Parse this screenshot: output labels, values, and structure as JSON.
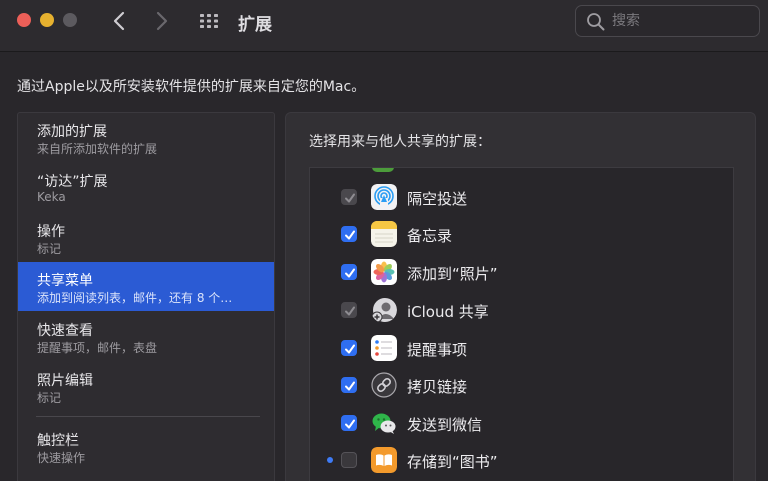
{
  "window": {
    "title": "扩展",
    "search_placeholder": "搜索"
  },
  "description": "通过Apple以及所安装软件提供的扩展来自定您的Mac。",
  "sidebar": {
    "items": [
      {
        "title": "添加的扩展",
        "subtitle": "来自所添加软件的扩展"
      },
      {
        "title": "“访达”扩展",
        "subtitle": "Keka"
      },
      {
        "title": "操作",
        "subtitle": "标记"
      },
      {
        "title": "共享菜单",
        "subtitle": "添加到阅读列表，邮件，还有 8 个…"
      },
      {
        "title": "快速查看",
        "subtitle": "提醒事项，邮件，表盘"
      },
      {
        "title": "照片编辑",
        "subtitle": "标记"
      },
      {
        "title": "触控栏",
        "subtitle": "快速操作"
      }
    ],
    "selected_index": 3
  },
  "right": {
    "header": "选择用来与他人共享的扩展：",
    "extensions": [
      {
        "label": "隔空投送",
        "icon": "airdrop-icon",
        "state": "checked-disabled"
      },
      {
        "label": "备忘录",
        "icon": "notes-icon",
        "state": "checked"
      },
      {
        "label": "添加到“照片”",
        "icon": "photos-icon",
        "state": "checked"
      },
      {
        "label": "iCloud 共享",
        "icon": "icloud-sharing-icon",
        "state": "checked-disabled"
      },
      {
        "label": "提醒事项",
        "icon": "reminders-icon",
        "state": "checked"
      },
      {
        "label": "拷贝链接",
        "icon": "copy-link-icon",
        "state": "checked"
      },
      {
        "label": "发送到微信",
        "icon": "wechat-icon",
        "state": "checked"
      },
      {
        "label": "存储到“图书”",
        "icon": "books-icon",
        "state": "unchecked",
        "new": true
      }
    ]
  },
  "colors": {
    "accent": "#2f6ef1",
    "selection": "#2b5bd4",
    "close": "#ec5f58",
    "minimize": "#e6b12f"
  }
}
